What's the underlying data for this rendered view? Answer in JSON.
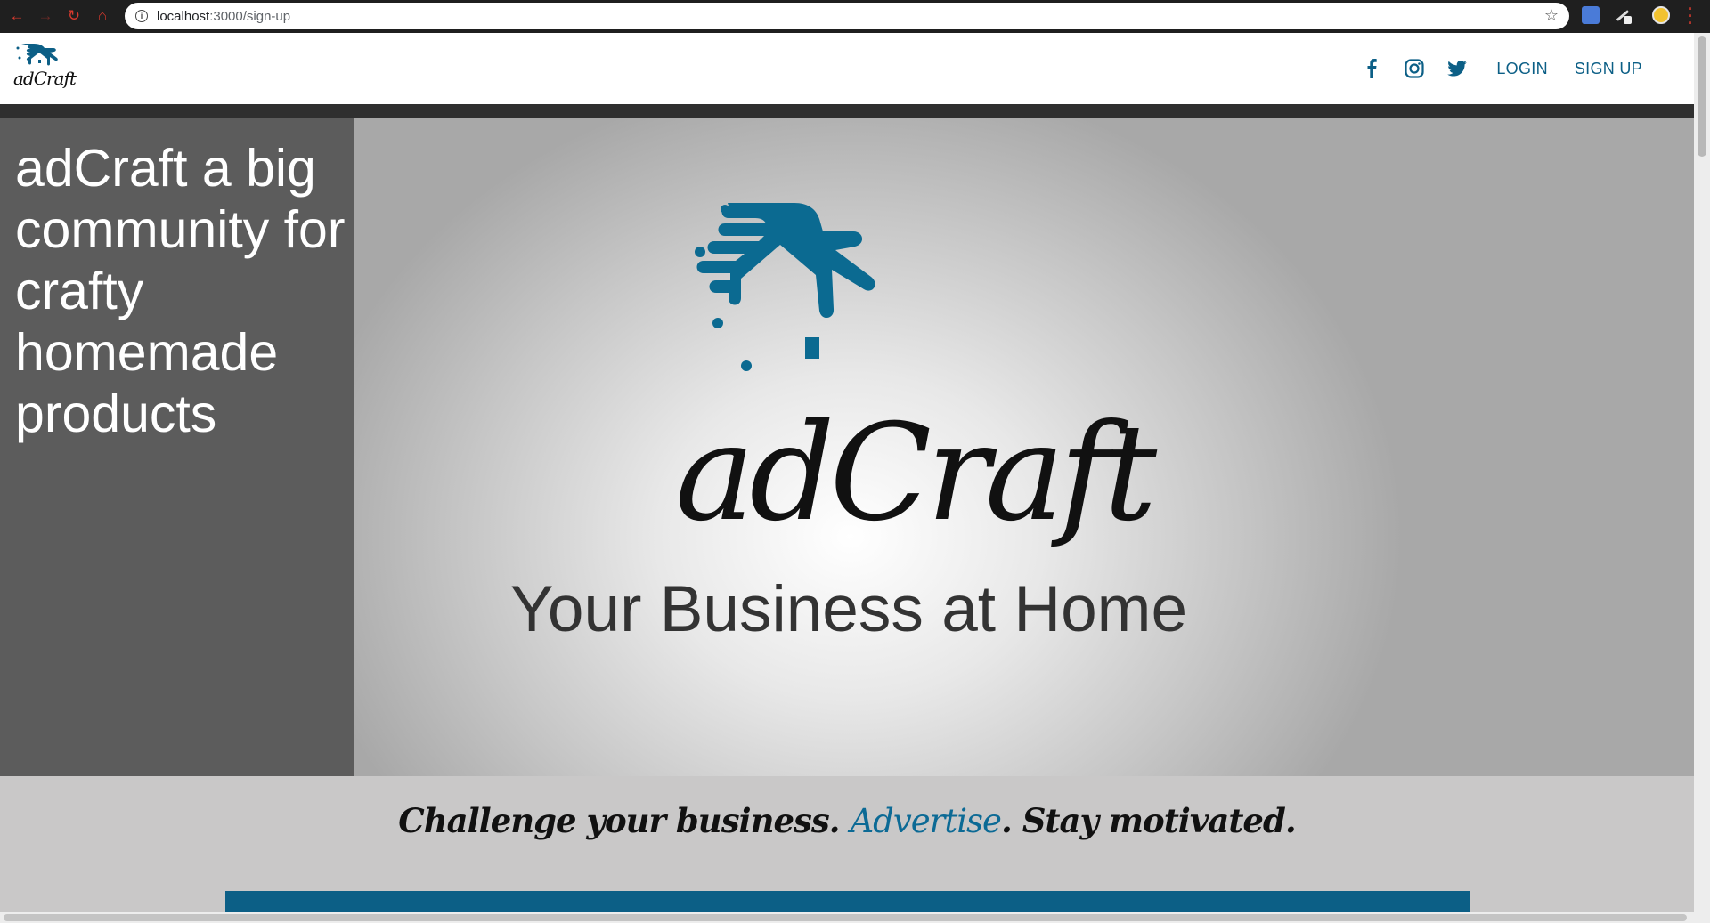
{
  "browser": {
    "url_host": "localhost",
    "url_path": ":3000/sign-up",
    "icons": [
      "back-icon",
      "forward-icon",
      "reload-icon",
      "home-icon",
      "info-icon",
      "star-icon",
      "translate-icon",
      "pen-icon",
      "profile-avatar",
      "menu-icon"
    ]
  },
  "header": {
    "logo_text": "adCraft",
    "social_icons": [
      "facebook-icon",
      "instagram-icon",
      "twitter-icon"
    ],
    "login_label": "LOGIN",
    "signup_label": "SIGN UP"
  },
  "hero": {
    "sidebar_text": "adCraft a big community for crafty homemade products",
    "brand_wordmark": "adCraft",
    "tagline": "Your Business at Home"
  },
  "slogan": {
    "part1": "Challenge your business. ",
    "accent": "Advertise",
    "part2": ". Stay motivated."
  },
  "colors": {
    "brand_blue": "#0c5f86",
    "active_underline": "#f29a36",
    "sidebar_bg": "#5c5c5c"
  }
}
